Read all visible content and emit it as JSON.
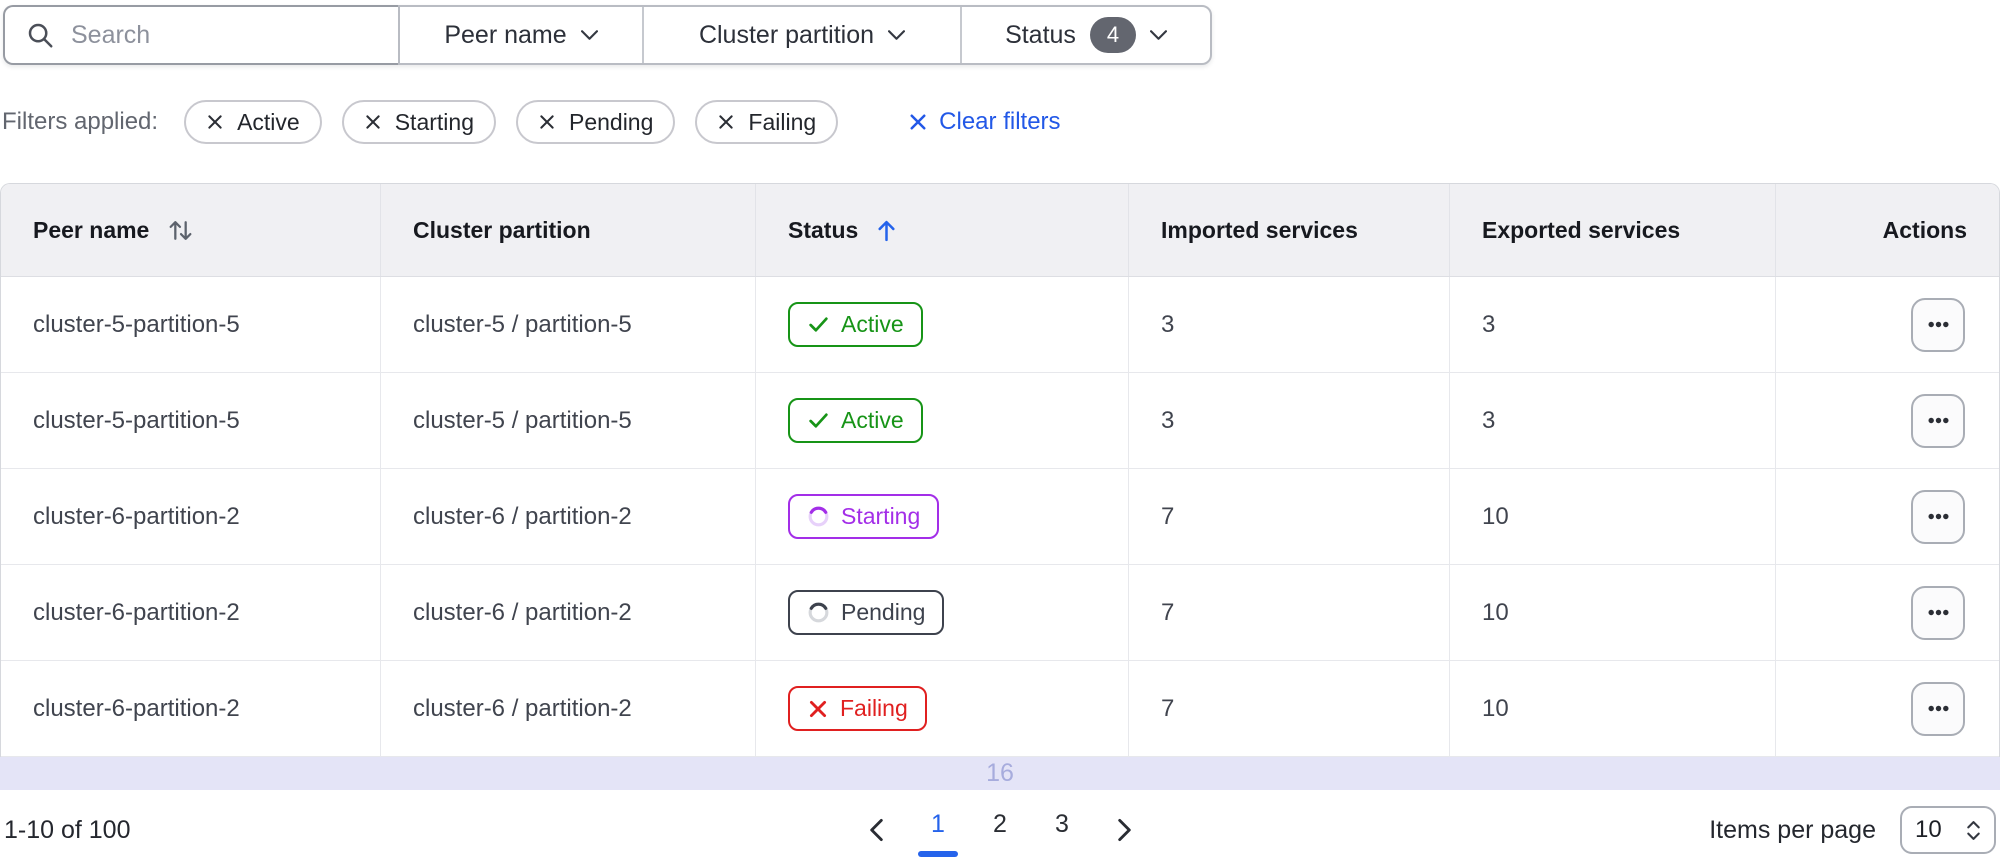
{
  "toolbar": {
    "search_placeholder": "Search",
    "dropdowns": [
      {
        "label": "Peer name"
      },
      {
        "label": "Cluster partition"
      },
      {
        "label": "Status",
        "count": "4"
      }
    ]
  },
  "filters": {
    "label": "Filters applied:",
    "chips": [
      "Active",
      "Starting",
      "Pending",
      "Failing"
    ],
    "clear_label": "Clear filters"
  },
  "table": {
    "columns": [
      {
        "label": "Peer name",
        "sort": "both"
      },
      {
        "label": "Cluster partition",
        "sort": "none"
      },
      {
        "label": "Status",
        "sort": "asc"
      },
      {
        "label": "Imported services",
        "sort": "none"
      },
      {
        "label": "Exported services",
        "sort": "none"
      },
      {
        "label": "Actions",
        "sort": "none"
      }
    ],
    "rows": [
      {
        "peer": "cluster-5-partition-5",
        "partition": "cluster-5 / partition-5",
        "status_label": "Active",
        "imported": "3",
        "exported": "3"
      },
      {
        "peer": "cluster-5-partition-5",
        "partition": "cluster-5 / partition-5",
        "status_label": "Active",
        "imported": "3",
        "exported": "3"
      },
      {
        "peer": "cluster-6-partition-2",
        "partition": "cluster-6 / partition-2",
        "status_label": "Starting",
        "imported": "7",
        "exported": "10"
      },
      {
        "peer": "cluster-6-partition-2",
        "partition": "cluster-6 / partition-2",
        "status_label": "Pending",
        "imported": "7",
        "exported": "10"
      },
      {
        "peer": "cluster-6-partition-2",
        "partition": "cluster-6 / partition-2",
        "status_label": "Failing",
        "imported": "7",
        "exported": "10"
      }
    ],
    "partial_row_text": "16"
  },
  "pagination": {
    "range_label": "1-10 of 100",
    "pages": [
      "1",
      "2",
      "3"
    ],
    "active_page": "1",
    "items_per_page_label": "Items per page",
    "items_per_page_value": "10"
  },
  "colors": {
    "accent_blue": "#2563eb",
    "link_blue": "#2258e7",
    "active_green": "#179417",
    "starting_purple": "#a32ee8",
    "pending_gray": "#3d424d",
    "failing_red": "#e02020",
    "header_bg": "#f0f0f3",
    "partial_row_bg": "#e4e4f7",
    "count_pill_bg": "#63666f"
  }
}
